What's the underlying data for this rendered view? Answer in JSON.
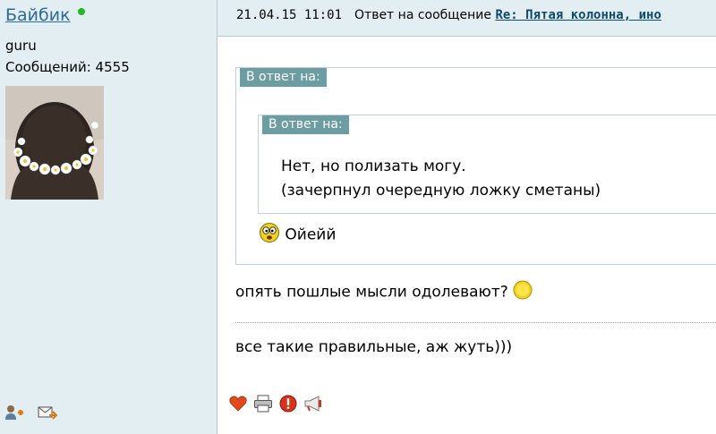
{
  "author": {
    "username": "Байбик",
    "online": true,
    "rank": "guru",
    "posts": "Сообщений: 4555"
  },
  "message": {
    "timestamp": "21.04.15 11:01",
    "relation": "Ответ на сообщение",
    "thread_title": "Re: Пятая колонна, ино"
  },
  "quote_outer": {
    "label": "В ответ на:",
    "reply_text": "Ойейй"
  },
  "quote_inner": {
    "label": "В ответ на:",
    "line1": "Нет, но полизать могу.",
    "line2": "(зачерпнул очередную ложку сметаны)"
  },
  "body": {
    "line1": "опять пошлые мысли одолевают?",
    "line2": "все такие правильные, аж жуть)))"
  },
  "icons": {
    "author_actions": [
      "add-friend-icon",
      "private-message-icon"
    ],
    "post_actions": [
      "like-heart-icon",
      "print-icon",
      "report-icon",
      "megaphone-icon"
    ]
  },
  "colors": {
    "sidebar_bg": "#e3eef3",
    "username": "#2b6a9b",
    "quote_label_bg": "#6b9da3",
    "thread_link": "#0c4b6e",
    "online": "#22bb22"
  }
}
